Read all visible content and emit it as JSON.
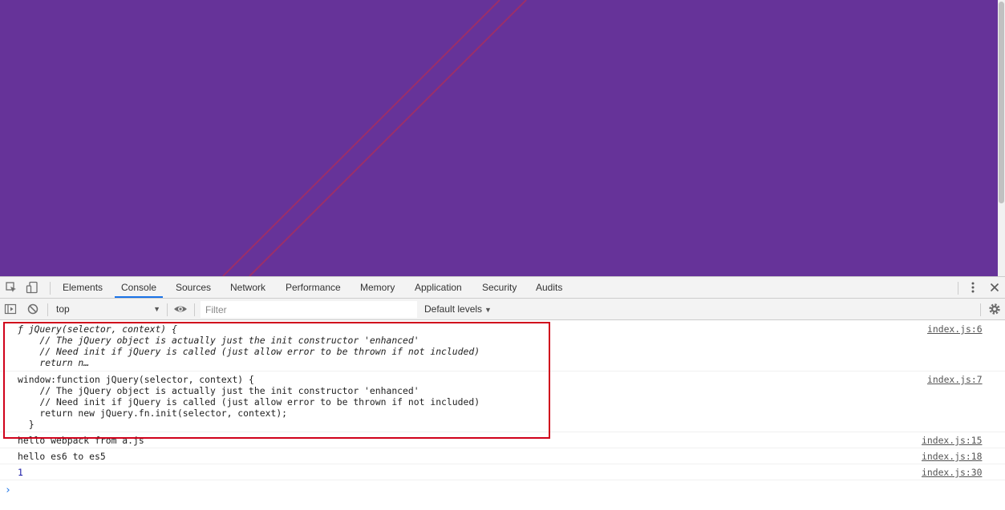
{
  "devtools": {
    "tabs": [
      "Elements",
      "Console",
      "Sources",
      "Network",
      "Performance",
      "Memory",
      "Application",
      "Security",
      "Audits"
    ],
    "active_tab": "Console",
    "icons": [
      "inspect-element-icon",
      "device-toolbar-icon",
      "more-options-icon",
      "close-icon"
    ]
  },
  "toolbar": {
    "context": "top",
    "filter_placeholder": "Filter",
    "levels_label": "Default levels"
  },
  "messages": [
    {
      "text": "ƒ jQuery(selector, context) {\n    // The jQuery object is actually just the init constructor 'enhanced'\n    // Need init if jQuery is called (just allow error to be thrown if not included)\n    return n…",
      "source": "index.js:6"
    },
    {
      "text": "window:function jQuery(selector, context) {\n    // The jQuery object is actually just the init constructor 'enhanced'\n    // Need init if jQuery is called (just allow error to be thrown if not included)\n    return new jQuery.fn.init(selector, context);\n  }",
      "source": "index.js:7"
    },
    {
      "text": "hello webpack from a.js",
      "source": "index.js:15"
    },
    {
      "text": "hello es6 to es5",
      "source": "index.js:18"
    },
    {
      "text": "1",
      "source": "index.js:30"
    }
  ],
  "prompt_symbol": "›",
  "colors": {
    "page_background": "#663399",
    "diagonal_lines": "#9b2f6a",
    "highlight_box": "#d0021b",
    "active_tab_underline": "#1a73e8"
  }
}
